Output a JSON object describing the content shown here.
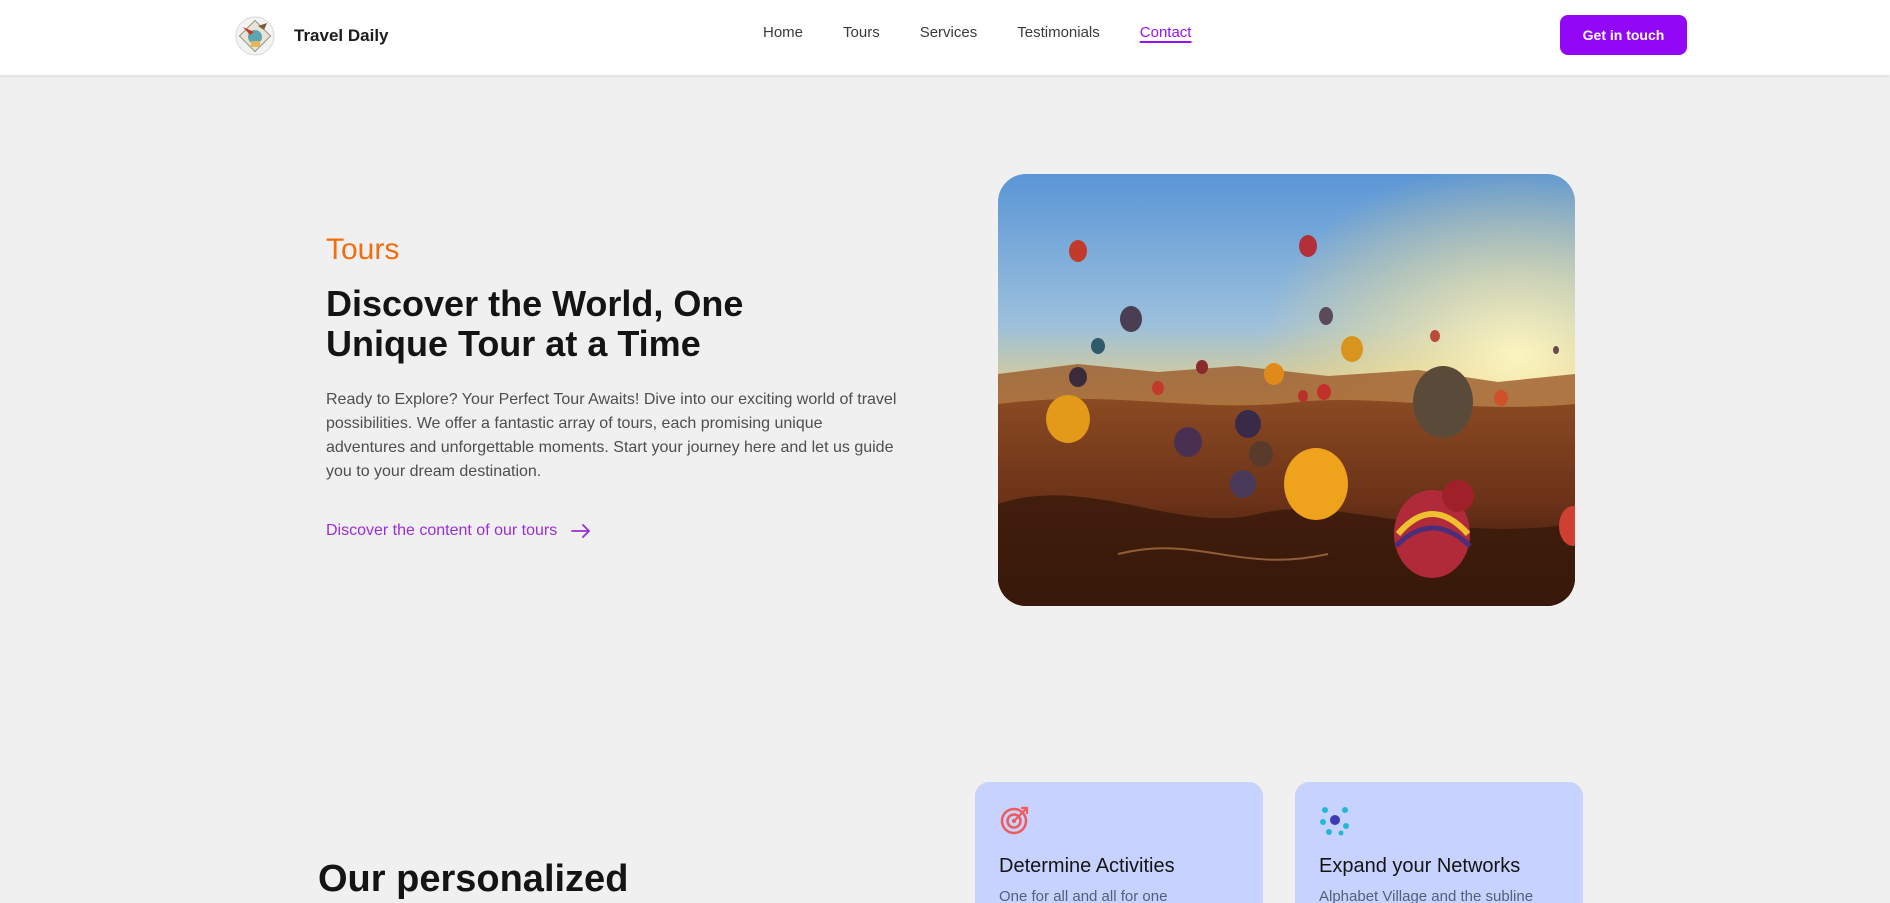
{
  "header": {
    "brand_name": "Travel Daily",
    "nav": [
      "Home",
      "Tours",
      "Services",
      "Testimonials",
      "Contact"
    ],
    "active_nav": "Contact",
    "cta_label": "Get in touch"
  },
  "hero": {
    "eyebrow": "Tours",
    "title": "Discover the World, One Unique Tour at a Time",
    "description": "Ready to Explore? Your Perfect Tour Awaits! Dive into our exciting world of travel possibilities. We offer a fantastic array of tours, each promising unique adventures and unforgettable moments. Start your journey here and let us guide you to your dream destination.",
    "link_label": "Discover the content of our tours",
    "link_icon": "arrow-right-icon",
    "image": "hot-air-balloons-over-valley-at-sunrise"
  },
  "services": {
    "section_title": "Our personalized",
    "cards": [
      {
        "icon": "target-icon",
        "title": "Determine Activities",
        "text": "One for all and all for one"
      },
      {
        "icon": "network-icon",
        "title": "Expand your Networks",
        "text": "Alphabet Village and the subline"
      }
    ]
  },
  "colors": {
    "accent": "#9208f6",
    "eyebrow": "#f26d12",
    "link": "#9a2ed8",
    "card_bg": "#c7d2fe",
    "page_bg": "#f0f0f0"
  }
}
